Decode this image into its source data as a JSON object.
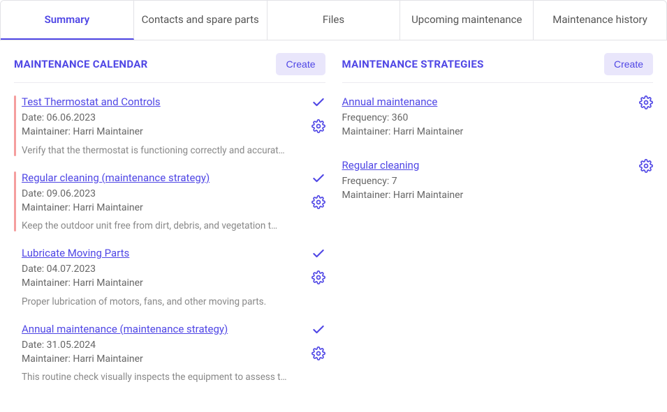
{
  "tabs": [
    {
      "label": "Summary",
      "active": true
    },
    {
      "label": "Contacts and spare parts",
      "active": false
    },
    {
      "label": "Files",
      "active": false
    },
    {
      "label": "Upcoming maintenance",
      "active": false
    },
    {
      "label": "Maintenance history",
      "active": false
    }
  ],
  "calendar": {
    "title": "MAINTENANCE CALENDAR",
    "create": "Create",
    "items": [
      {
        "title": "Test Thermostat and Controls",
        "date": "Date: 06.06.2023",
        "maintainer": "Maintainer: Harri Maintainer",
        "desc": "Verify that the thermostat is functioning correctly and accurat…",
        "accent": true
      },
      {
        "title": "Regular cleaning (maintenance strategy)",
        "date": "Date: 09.06.2023",
        "maintainer": "Maintainer: Harri Maintainer",
        "desc": "Keep the outdoor unit free from dirt, debris, and vegetation t…",
        "accent": true
      },
      {
        "title": "Lubricate Moving Parts",
        "date": "Date: 04.07.2023",
        "maintainer": "Maintainer: Harri Maintainer",
        "desc": "Proper lubrication of motors, fans, and other moving parts.",
        "accent": false
      },
      {
        "title": "Annual maintenance (maintenance strategy)",
        "date": "Date: 31.05.2024",
        "maintainer": "Maintainer: Harri Maintainer",
        "desc": "This routine check visually inspects the equipment to assess t…",
        "accent": false
      }
    ]
  },
  "strategies": {
    "title": "MAINTENANCE STRATEGIES",
    "create": "Create",
    "items": [
      {
        "title": "Annual maintenance",
        "freq": "Frequency: 360",
        "maintainer": "Maintainer: Harri Maintainer"
      },
      {
        "title": "Regular cleaning",
        "freq": "Frequency: 7",
        "maintainer": "Maintainer: Harri Maintainer"
      }
    ]
  }
}
